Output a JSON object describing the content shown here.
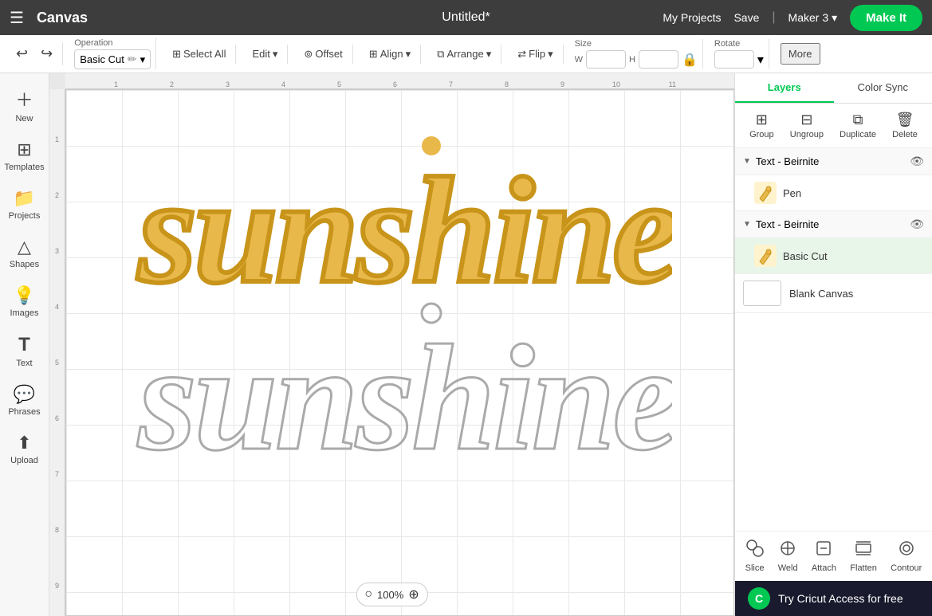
{
  "app": {
    "name": "Canvas",
    "project_title": "Untitled*"
  },
  "top_nav": {
    "my_projects": "My Projects",
    "save": "Save",
    "divider": "|",
    "machine": "Maker 3",
    "make_it": "Make It"
  },
  "toolbar": {
    "undo_icon": "↩",
    "redo_icon": "↪",
    "operation_label": "Operation",
    "operation_value": "Basic Cut",
    "select_all": "Select All",
    "edit": "Edit",
    "offset": "Offset",
    "align": "Align",
    "arrange": "Arrange",
    "flip": "Flip",
    "size_label": "Size",
    "size_w_label": "W",
    "size_h_label": "H",
    "rotate_label": "Rotate",
    "more": "More"
  },
  "sidebar": {
    "items": [
      {
        "label": "New",
        "icon": "+"
      },
      {
        "label": "Templates",
        "icon": "⊞"
      },
      {
        "label": "Projects",
        "icon": "📁"
      },
      {
        "label": "Shapes",
        "icon": "△"
      },
      {
        "label": "Images",
        "icon": "💡"
      },
      {
        "label": "Text",
        "icon": "T"
      },
      {
        "label": "Phrases",
        "icon": "💬"
      },
      {
        "label": "Upload",
        "icon": "⬆"
      }
    ]
  },
  "canvas": {
    "zoom": "100%",
    "zoom_in": "+",
    "zoom_out": "−",
    "ruler_marks_h": [
      "1",
      "2",
      "3",
      "4",
      "5",
      "6",
      "7",
      "8",
      "9",
      "10",
      "11"
    ],
    "ruler_marks_v": [
      "1",
      "2",
      "3",
      "4",
      "5",
      "6",
      "7",
      "8",
      "9"
    ]
  },
  "layers_panel": {
    "tabs": [
      {
        "label": "Layers",
        "active": true
      },
      {
        "label": "Color Sync",
        "active": false
      }
    ],
    "actions": [
      {
        "label": "Group",
        "icon": "⊞",
        "disabled": false
      },
      {
        "label": "Ungroup",
        "icon": "⊟",
        "disabled": false
      },
      {
        "label": "Duplicate",
        "icon": "⧉",
        "disabled": false
      },
      {
        "label": "Delete",
        "icon": "🗑",
        "disabled": false
      }
    ],
    "groups": [
      {
        "name": "Text - Beirnite",
        "expanded": true,
        "items": [
          {
            "name": "Pen",
            "color": "#e8b84b",
            "operation": "Pen"
          }
        ]
      },
      {
        "name": "Text - Beirnite",
        "expanded": true,
        "items": [
          {
            "name": "Basic Cut",
            "color": "#e8b84b",
            "operation": "Basic Cut",
            "selected": true
          }
        ]
      }
    ],
    "blank_canvas": "Blank Canvas"
  },
  "bottom_actions": [
    {
      "label": "Slice",
      "icon": "⧄"
    },
    {
      "label": "Weld",
      "icon": "⊕"
    },
    {
      "label": "Attach",
      "icon": "📎"
    },
    {
      "label": "Flatten",
      "icon": "⊡"
    },
    {
      "label": "Contour",
      "icon": "◎"
    }
  ],
  "cricut_banner": {
    "icon": "C",
    "text": "Try Cricut Access for free"
  }
}
